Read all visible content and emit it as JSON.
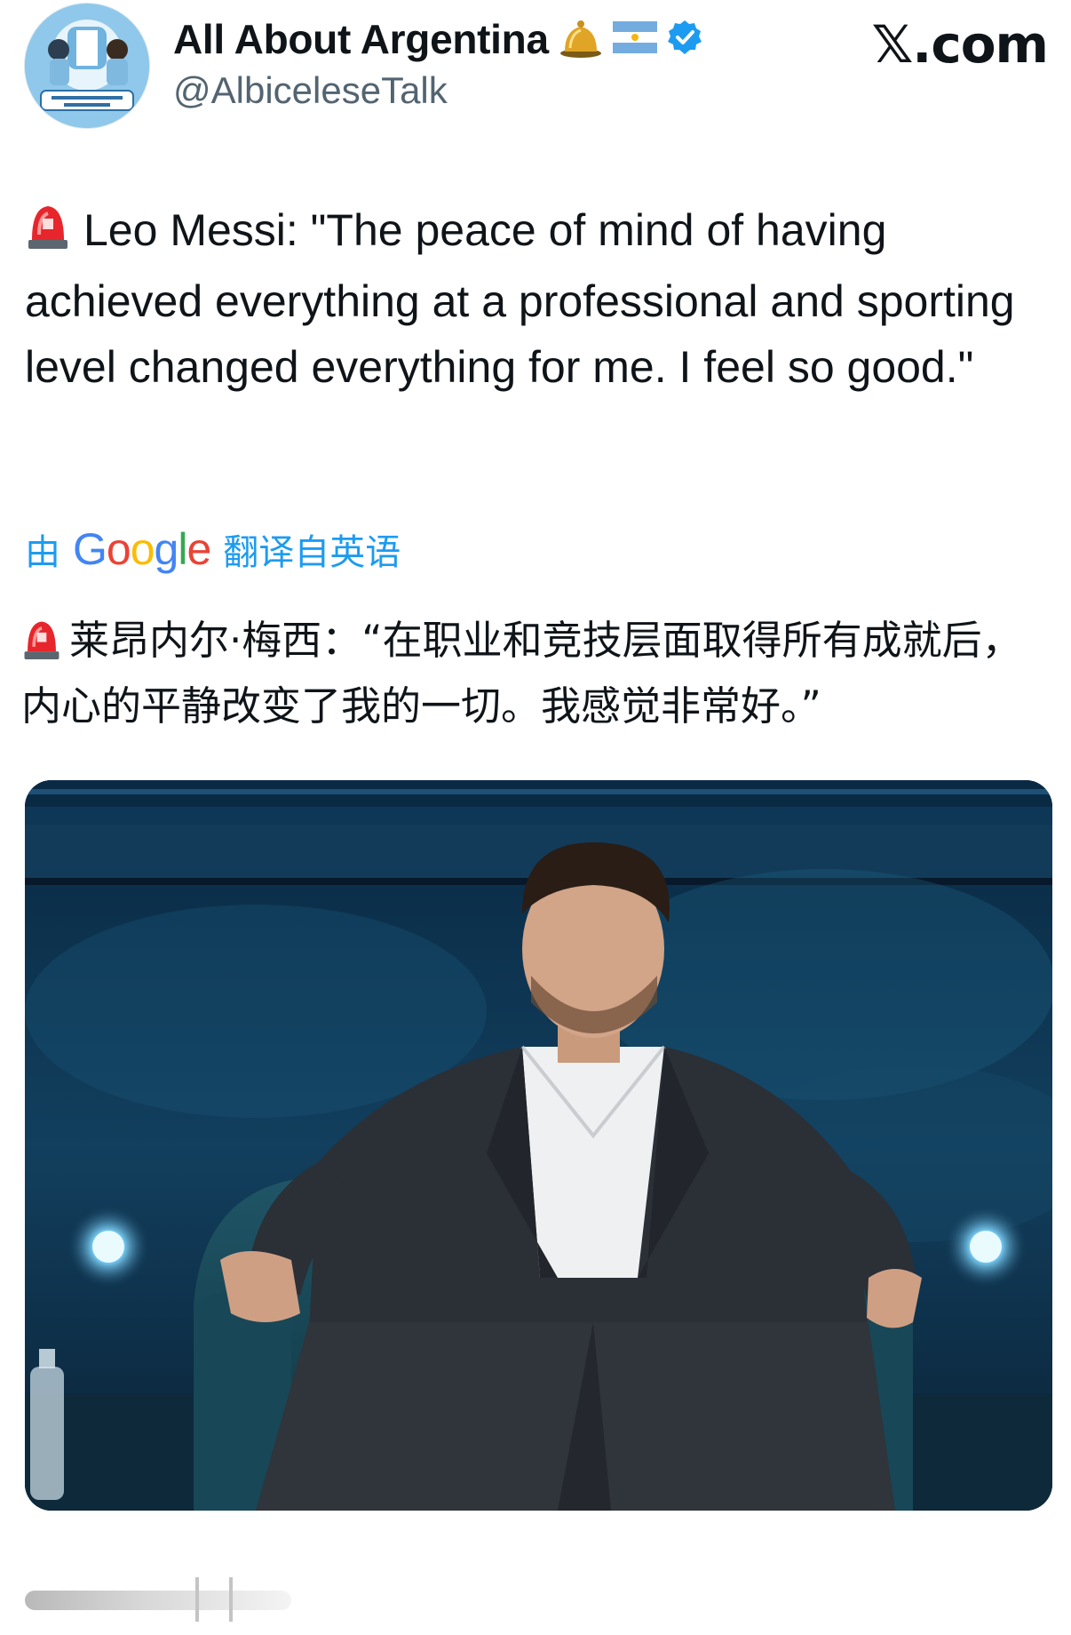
{
  "header": {
    "display_name": "All About Argentina",
    "handle": "@AlbiceleseTalk",
    "brand": "𝕏.com",
    "avatar_icon": "team-crest-avatar",
    "name_emojis": [
      "bell-icon",
      "argentina-flag-icon",
      "verified-badge-icon"
    ],
    "verified_color": "#1d9bf0"
  },
  "tweet": {
    "leading_icon": "police-siren-icon",
    "text": "Leo Messi: \"The peace of mind of having achieved everything at a professional and sporting level changed everything for me. I feel so good.\""
  },
  "translation": {
    "by": "由",
    "provider": "Google",
    "from": "翻译自英语",
    "text": "莱昂内尔·梅西：“在职业和竞技层面取得所有成就后，内心的平静改变了我的一切。我感觉非常好。”",
    "link_color": "#1d9bf0"
  },
  "media": {
    "type": "photo",
    "subject": "man-in-dark-suit-seated-on-stage-photo"
  }
}
